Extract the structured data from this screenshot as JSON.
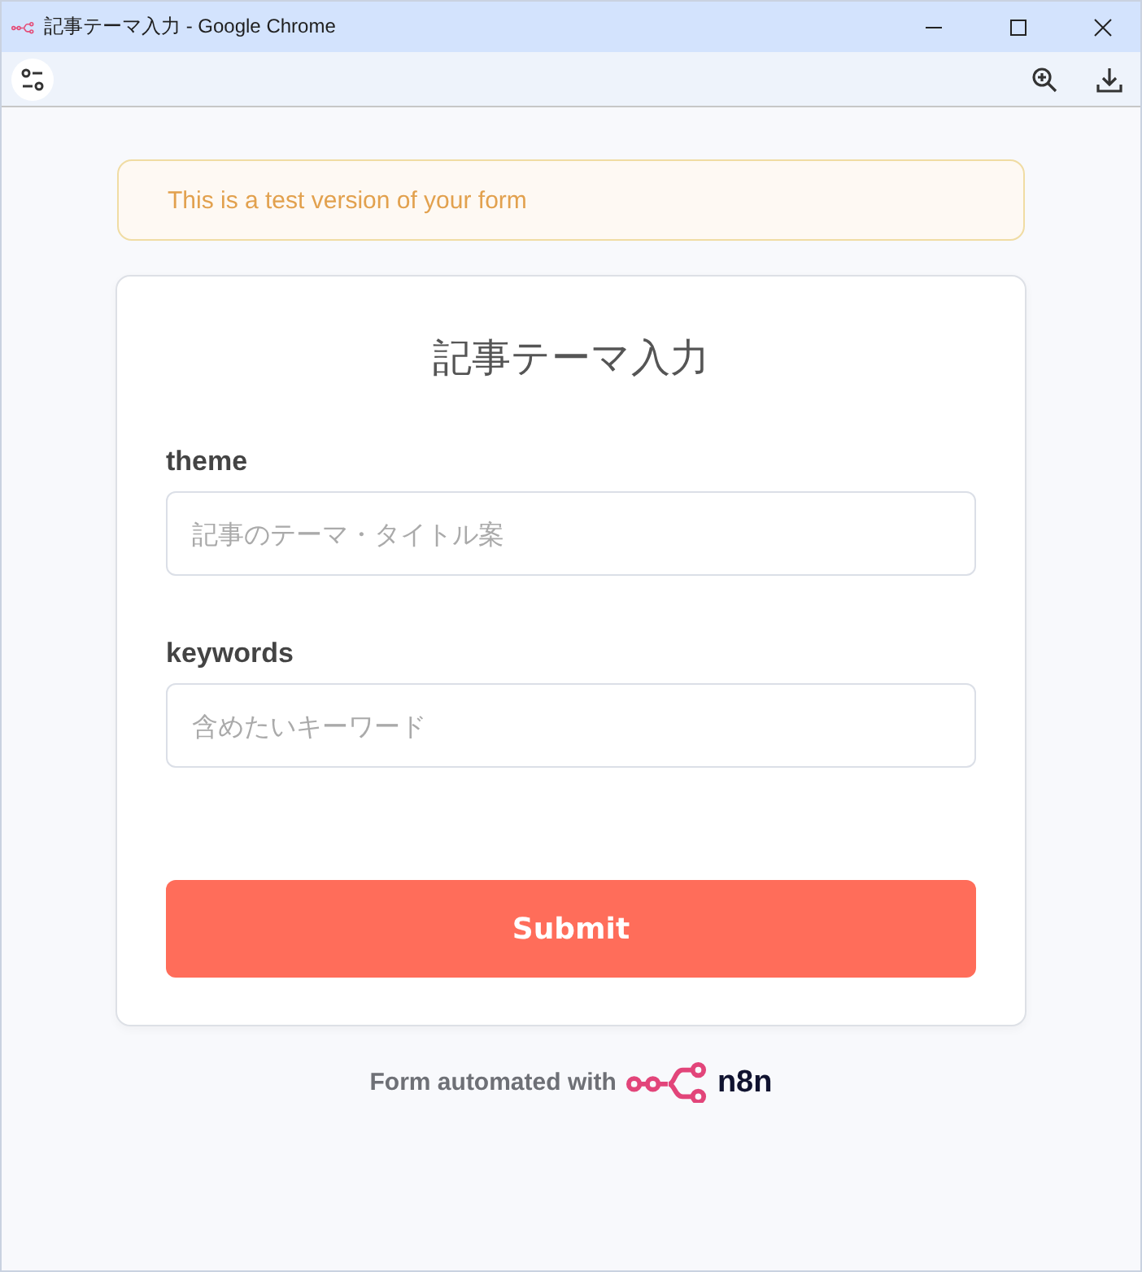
{
  "window": {
    "title": "記事テーマ入力 - Google Chrome"
  },
  "banner": {
    "text": "This is a test version of your form"
  },
  "form": {
    "title": "記事テーマ入力",
    "fields": [
      {
        "label": "theme",
        "placeholder": "記事のテーマ・タイトル案"
      },
      {
        "label": "keywords",
        "placeholder": "含めたいキーワード"
      }
    ],
    "submit": "Submit"
  },
  "footer": {
    "text": "Form automated with",
    "brand": "n8n"
  }
}
